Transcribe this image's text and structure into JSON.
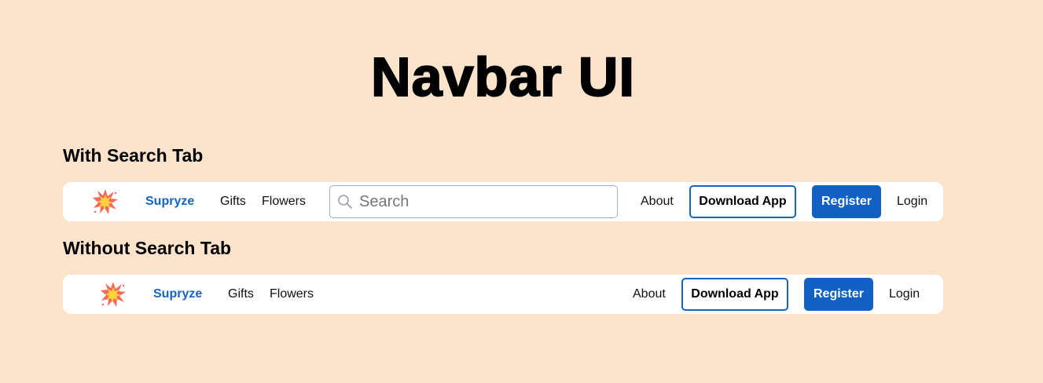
{
  "page": {
    "title": "Navbar UI"
  },
  "sections": [
    {
      "title": "With Search Tab",
      "navbar": {
        "logo_icon": "burst-icon",
        "brand": "Supryze",
        "links": [
          "Gifts",
          "Flowers"
        ],
        "search_placeholder": "Search",
        "about": "About",
        "download_label": "Download App",
        "register_label": "Register",
        "login_label": "Login"
      }
    },
    {
      "title": "Without Search Tab",
      "navbar": {
        "logo_icon": "burst-icon",
        "brand": "Supryze",
        "links": [
          "Gifts",
          "Flowers"
        ],
        "about": "About",
        "download_label": "Download App",
        "register_label": "Register",
        "login_label": "Login"
      }
    }
  ],
  "colors": {
    "background": "#fbe3cc",
    "accent": "#1160c4",
    "brand_text": "#1565c0",
    "navbar_bg": "#ffffff"
  }
}
